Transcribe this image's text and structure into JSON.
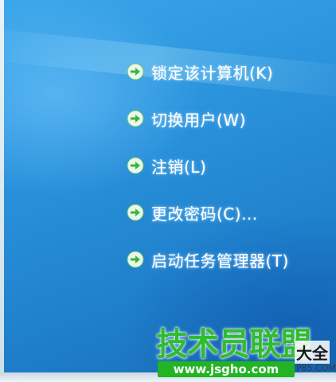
{
  "menu": {
    "items": [
      {
        "label": "锁定该计算机(K)",
        "icon": "green-arrow-icon"
      },
      {
        "label": "切换用户(W)",
        "icon": "green-arrow-icon"
      },
      {
        "label": "注销(L)",
        "icon": "green-arrow-icon"
      },
      {
        "label": "更改密码(C)...",
        "icon": "green-arrow-icon"
      },
      {
        "label": "启动任务管理器(T)",
        "icon": "green-arrow-icon"
      }
    ]
  },
  "watermark": {
    "title": "技术员联盟",
    "suffix": "大全",
    "url": "www.jsgho.com",
    "url_small": "P85.COM"
  },
  "colors": {
    "background_top": "#3aa6ea",
    "background_bottom": "#1a6cb5",
    "arrow_green": "#3cb43c",
    "watermark_green": "#2ebd2e"
  }
}
